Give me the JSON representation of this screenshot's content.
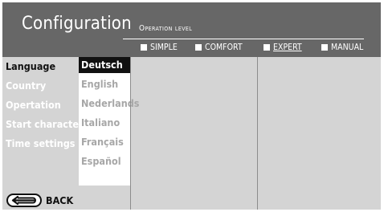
{
  "header": {
    "title": "Configuration",
    "operation_level_label": "Operation level",
    "levels": [
      {
        "label": "SIMPLE",
        "selected": false
      },
      {
        "label": "COMFORT",
        "selected": false
      },
      {
        "label": "EXPERT",
        "selected": true
      },
      {
        "label": "MANUAL",
        "selected": false
      }
    ]
  },
  "menu": {
    "items": [
      {
        "label": "Language",
        "active": true
      },
      {
        "label": "Country",
        "active": false
      },
      {
        "label": "Opertation",
        "active": false
      },
      {
        "label": "Start characteri",
        "active": false
      },
      {
        "label": "Time settings",
        "active": false
      }
    ]
  },
  "languages": {
    "items": [
      "Deutsch",
      "English",
      "Nederlands",
      "Italiano",
      "Français",
      "Español"
    ],
    "selected": "Deutsch"
  },
  "footer": {
    "back_label": "BACK",
    "back_icon": "back-arrow-icon"
  },
  "colors": {
    "header_bg": "#676767",
    "panel_bg": "#d4d4d4",
    "selected_bg": "#111111",
    "inactive_text": "#a7a7a7"
  }
}
